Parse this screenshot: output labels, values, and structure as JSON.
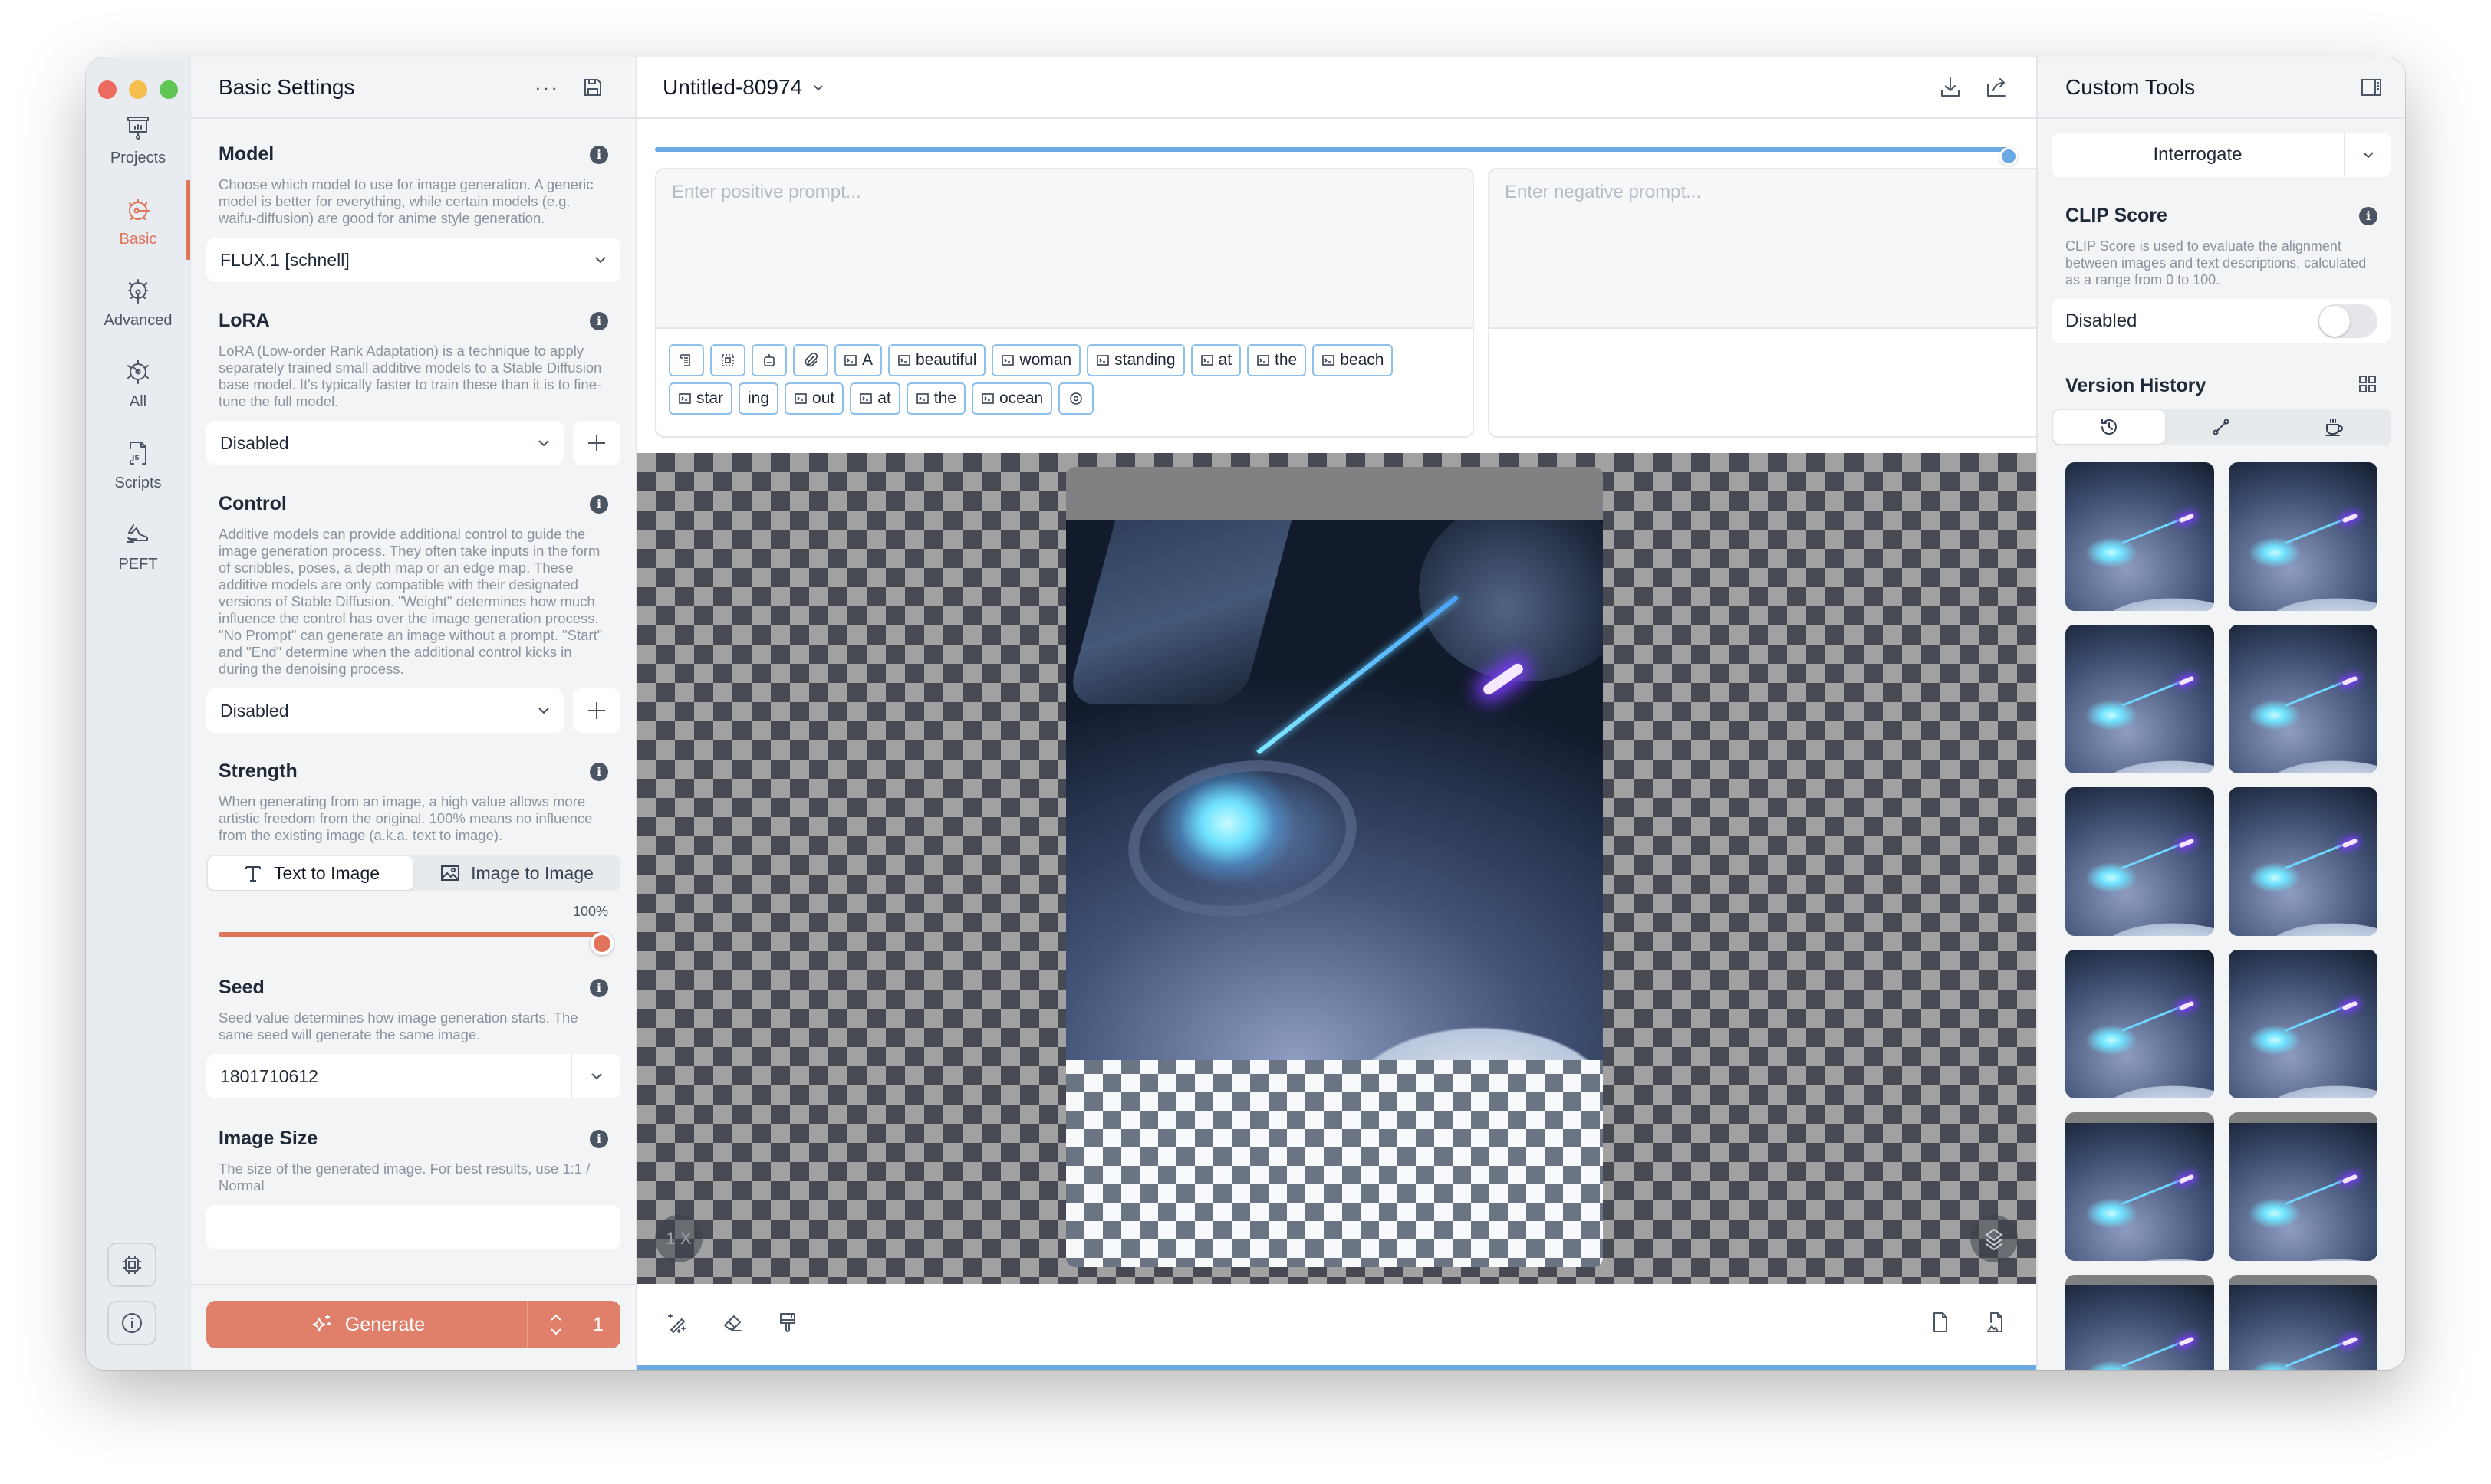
{
  "window": {
    "traffic_lights": [
      "close",
      "minimize",
      "zoom"
    ]
  },
  "rail": {
    "items": [
      {
        "label": "Projects",
        "icon": "presentation-board-icon",
        "active": false
      },
      {
        "label": "Basic",
        "icon": "gauge-basic-icon",
        "active": true
      },
      {
        "label": "Advanced",
        "icon": "gauge-advanced-icon",
        "active": false
      },
      {
        "label": "All",
        "icon": "gauge-all-icon",
        "active": false
      },
      {
        "label": "Scripts",
        "icon": "js-file-icon",
        "active": false
      },
      {
        "label": "PEFT",
        "icon": "sneaker-icon",
        "active": false
      }
    ],
    "bottom_buttons": [
      "chip-icon",
      "info-circle-icon"
    ]
  },
  "left_panel": {
    "title": "Basic Settings",
    "more_icon": "ellipsis-icon",
    "save_icon": "save-floppy-icon",
    "sections": {
      "model": {
        "title": "Model",
        "description": "Choose which model to use for image generation. A generic model is better for everything, while certain models (e.g. waifu-diffusion) are good for anime style generation.",
        "value": "FLUX.1 [schnell]"
      },
      "lora": {
        "title": "LoRA",
        "description": "LoRA (Low-order Rank Adaptation) is a technique to apply separately trained small additive models to a Stable Diffusion base model. It's typically faster to train these than it is to fine-tune the full model.",
        "value": "Disabled"
      },
      "control": {
        "title": "Control",
        "description": "Additive models can provide additional control to guide the image generation process. They often take inputs in the form of scribbles, poses, a depth map or an edge map. These additive models are only compatible with their designated versions of Stable Diffusion. \"Weight\" determines how much influence the control has over the image generation process. \"No Prompt\" can generate an image without a prompt. \"Start\" and \"End\" determine when the additional control kicks in during the denoising process.",
        "value": "Disabled"
      },
      "strength": {
        "title": "Strength",
        "description": "When generating from an image, a high value allows more artistic freedom from the original. 100% means no influence from the existing image (a.k.a. text to image).",
        "modes": [
          "Text to Image",
          "Image to Image"
        ],
        "active_mode": "Text to Image",
        "value_label": "100%",
        "value": 1.0
      },
      "seed": {
        "title": "Seed",
        "description": "Seed value determines how image generation starts. The same seed will generate the same image.",
        "value": "1801710612"
      },
      "image_size": {
        "title": "Image Size",
        "description": "The size of the generated image. For best results, use 1:1 / Normal"
      }
    },
    "generate": {
      "label": "Generate",
      "count": "1"
    }
  },
  "main": {
    "title": "Untitled-80974",
    "header_icons": [
      "download-icon",
      "share-icon"
    ],
    "progress": 1.0,
    "positive_prompt": {
      "placeholder": "Enter positive prompt...",
      "tool_chips": [
        "scroll-icon",
        "select-frame-icon",
        "robot-icon",
        "paperclip-icon"
      ],
      "tokens": [
        "A",
        "beautiful",
        "woman",
        "standing",
        "at",
        "the",
        "beach",
        "star",
        "ing",
        "out",
        "at",
        "the",
        "ocean"
      ],
      "tokens_without_icon": [
        "ing"
      ],
      "trailing_chip": "target-icon"
    },
    "negative_prompt": {
      "placeholder": "Enter negative prompt..."
    },
    "canvas": {
      "zoom_label": "1 X",
      "layers_icon": "layers-icon"
    },
    "bottom_tools_left": [
      "magic-wand-icon",
      "eraser-icon",
      "paint-brush-icon"
    ],
    "bottom_tools_right": [
      "blank-document-icon",
      "image-document-icon"
    ]
  },
  "right_panel": {
    "title": "Custom Tools",
    "toggle_sidebar_icon": "sidebar-right-icon",
    "interrogate_label": "Interrogate",
    "clip_score": {
      "title": "CLIP Score",
      "description": "CLIP Score is used to evaluate the alignment between images and text descriptions, calculated as a range from 0 to 100.",
      "toggle_label": "Disabled",
      "enabled": false
    },
    "version_history": {
      "title": "Version History",
      "grid_icon": "grid-icon",
      "tabs": [
        "history-icon",
        "path-icon",
        "coffee-cup-icon"
      ],
      "active_tab": 0,
      "thumbnail_count": 12
    }
  }
}
